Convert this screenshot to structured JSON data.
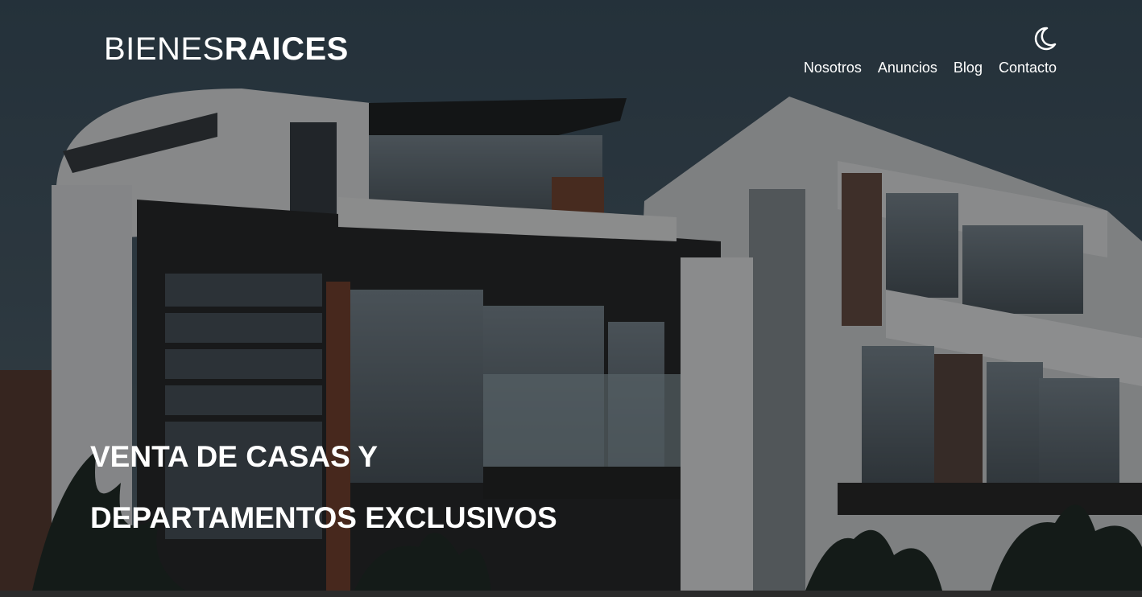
{
  "brand": {
    "light": "BIENES",
    "bold": "RAICES"
  },
  "header": {
    "theme_toggle_icon": "moon-icon"
  },
  "nav": {
    "items": [
      {
        "label": "Nosotros"
      },
      {
        "label": "Anuncios"
      },
      {
        "label": "Blog"
      },
      {
        "label": "Contacto"
      }
    ]
  },
  "hero": {
    "title_line1": "VENTA DE CASAS Y",
    "title_line2": "DEPARTAMENTOS EXCLUSIVOS",
    "image_icon": "modern-house-photo"
  },
  "colors": {
    "text": "#ffffff",
    "overlay": "rgba(0,0,0,0.42)"
  }
}
